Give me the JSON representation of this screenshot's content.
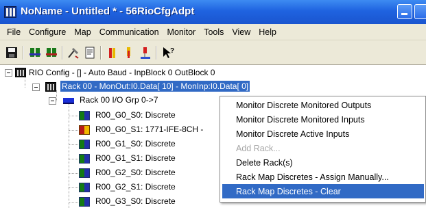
{
  "window": {
    "title": "NoName - Untitled * - 56RioCfgAdpt"
  },
  "menubar": {
    "items": [
      {
        "label": "File"
      },
      {
        "label": "Configure"
      },
      {
        "label": "Map"
      },
      {
        "label": "Communication"
      },
      {
        "label": "Monitor"
      },
      {
        "label": "Tools"
      },
      {
        "label": "View"
      },
      {
        "label": "Help"
      }
    ]
  },
  "toolbar": {
    "buttons": [
      "save-icon",
      "connect-icon",
      "disconnect-icon",
      "tools-icon",
      "document-icon",
      "io-module-icon",
      "io-module-alt-icon",
      "network-icon",
      "help-pointer-icon"
    ]
  },
  "tree": {
    "root": {
      "label": "RIO Config - [] - Auto Baud - InpBlock 0 OutBlock 0",
      "icon": "rio-config-icon"
    },
    "rack": {
      "label": "Rack 00 - MonOut:I0.Data[ 10] - MonInp:I0.Data[  0]",
      "icon": "rack-icon",
      "selected": true
    },
    "group": {
      "label": "Rack 00 I/O Grp 0->7",
      "icon": "io-group-icon"
    },
    "slots": [
      {
        "label": "R00_G0_S0: Discrete",
        "icon": "discrete-module-icon"
      },
      {
        "label": "R00_G0_S1: 1771-IFE-8CH -",
        "icon": "analog-module-icon"
      },
      {
        "label": "R00_G1_S0: Discrete",
        "icon": "discrete-module-icon"
      },
      {
        "label": "R00_G1_S1: Discrete",
        "icon": "discrete-module-icon"
      },
      {
        "label": "R00_G2_S0: Discrete",
        "icon": "discrete-module-icon"
      },
      {
        "label": "R00_G2_S1: Discrete",
        "icon": "discrete-module-icon"
      },
      {
        "label": "R00_G3_S0: Discrete",
        "icon": "discrete-module-icon"
      }
    ]
  },
  "context_menu": {
    "items": [
      {
        "label": "Monitor Discrete Monitored Outputs",
        "disabled": false
      },
      {
        "label": "Monitor Discrete Monitored Inputs",
        "disabled": false
      },
      {
        "label": "Monitor Discrete Active Inputs",
        "disabled": false
      },
      {
        "label": "Add Rack...",
        "disabled": true
      },
      {
        "label": "Delete Rack(s)",
        "disabled": false
      },
      {
        "label": "Rack Map Discretes - Assign Manually...",
        "disabled": false
      },
      {
        "label": "Rack Map Discretes - Clear",
        "disabled": false,
        "highlighted": true
      }
    ]
  },
  "colors": {
    "titlebar": "#1f63e0",
    "selection": "#316ac5",
    "menu_bg": "#ece9d8"
  }
}
